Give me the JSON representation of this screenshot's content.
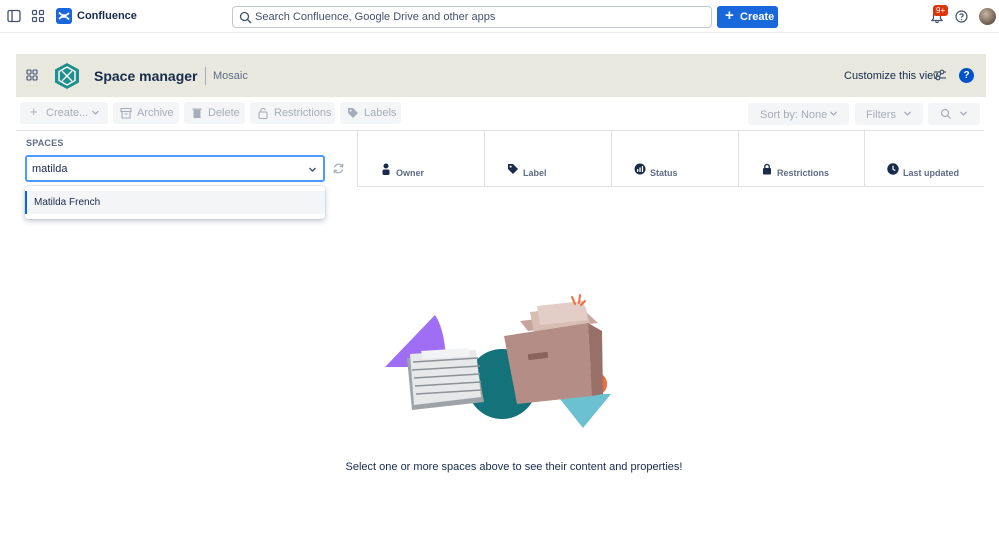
{
  "topnav": {
    "brand": "Confluence",
    "search_placeholder": "Search Confluence, Google Drive and other apps",
    "create_label": "Create",
    "notification_badge": "9+"
  },
  "banner": {
    "title": "Space manager",
    "subtitle": "Mosaic",
    "customize_label": "Customize this view",
    "help_label": "?"
  },
  "toolbar": {
    "create": "Create...",
    "archive": "Archive",
    "delete": "Delete",
    "restrictions": "Restrictions",
    "labels": "Labels",
    "sort": "Sort by: None",
    "filters": "Filters"
  },
  "spaces": {
    "label": "SPACES",
    "input_value": "matilda",
    "options": [
      "Matilda French"
    ]
  },
  "columns": [
    "Owner",
    "Label",
    "Status",
    "Restrictions",
    "Last updated"
  ],
  "empty_state": {
    "message": "Select one or more spaces above to see their content and properties!"
  },
  "colors": {
    "accent": "#1868db",
    "banner_bg": "#e8e8df",
    "focus_border": "#4c9aff"
  }
}
